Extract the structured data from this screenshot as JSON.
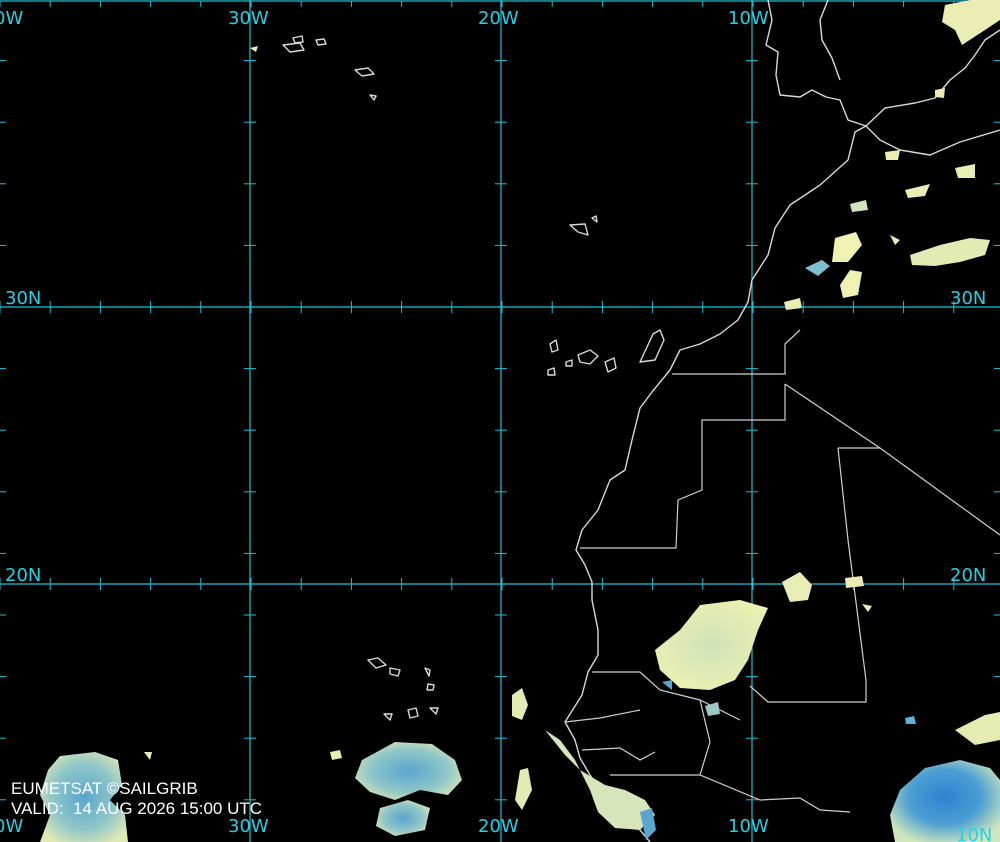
{
  "grid": {
    "lon_labels_top": [
      "0W",
      "30W",
      "20W",
      "10W"
    ],
    "lon_labels_bottom": [
      "0W",
      "30W",
      "20W",
      "10W"
    ],
    "lat_labels_left": [
      "30N",
      "20N"
    ],
    "lat_labels_right": [
      "30N",
      "20N",
      "10N"
    ],
    "line_color": "#19c4d6"
  },
  "credit": {
    "source": "EUMETSAT ©SAILGRIB",
    "valid": "VALID:  14 AUG 2026 15:00 UTC"
  },
  "colors": {
    "background": "#000000",
    "coastline": "#d9d9d9",
    "cloud_light": "#e6ebb0",
    "cloud_mid": "#a9d4c2",
    "cloud_dense": "#3b8fd0"
  }
}
